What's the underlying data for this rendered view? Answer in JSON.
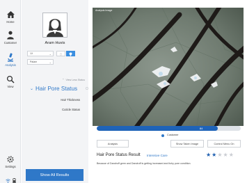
{
  "nav": {
    "items": [
      {
        "label": "Home",
        "icon": "home-icon"
      },
      {
        "label": "Customer",
        "icon": "person-icon"
      },
      {
        "label": "Analysis",
        "icon": "microscope-icon",
        "active": true
      },
      {
        "label": "View",
        "icon": "search-icon"
      }
    ],
    "settings_label": "Settings",
    "settings_icon": "gear-icon",
    "footer_icons": [
      "wifi-icon",
      "battery-icon"
    ]
  },
  "patient": {
    "name": "Aram Huvis",
    "lens_select": "1X",
    "mode_select": "Palam"
  },
  "sidebar": {
    "view_less": "View Less Status",
    "section_title": "Hair Pore Status",
    "sub_items": [
      "Hair Thickness",
      "Cuticle Status"
    ],
    "show_all": "Show All Results"
  },
  "image_panel": {
    "label": "Analysis Image",
    "progress_value": "84",
    "progress_fraction": 0.84,
    "radio_label": "Customer",
    "buttons": [
      "Analysis",
      "Show Taken Image",
      "Control Menu On"
    ]
  },
  "result": {
    "title": "Hair Pore Status Result",
    "badge": "Intensive Care",
    "rating": 2,
    "rating_max": 5,
    "description": "Because of Dandruff germ and Dandruff is getting increased and itchy pore condition."
  },
  "colors": {
    "accent": "#2f78c8",
    "star_filled": "#1f5fb0",
    "star_empty": "#c9ccd2"
  }
}
